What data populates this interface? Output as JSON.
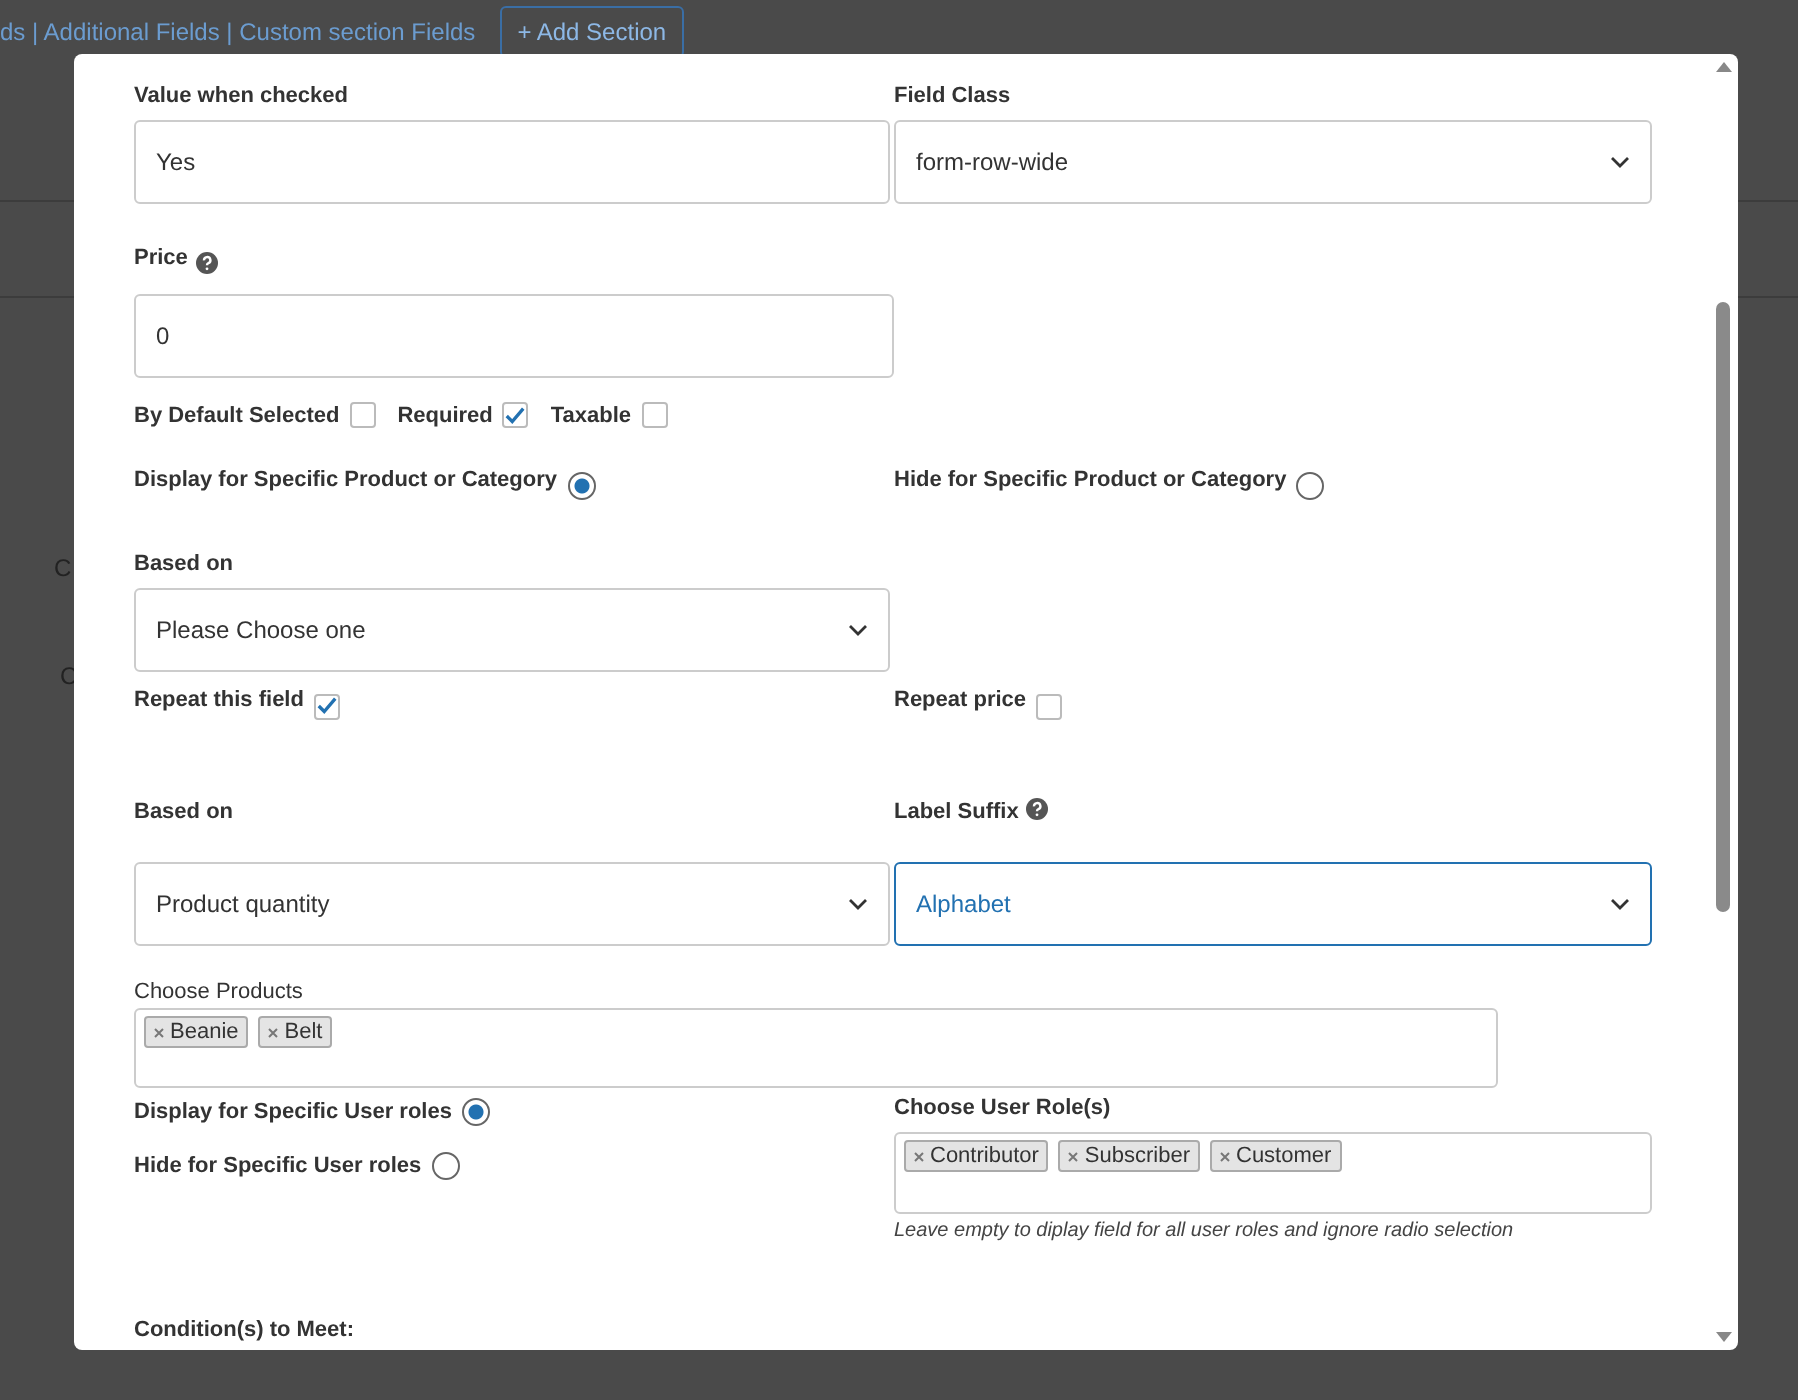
{
  "background": {
    "nav_text": "ds | Additional Fields | Custom section Fields",
    "add_section_button": "+ Add Section",
    "cut_labels": [
      "C",
      "C"
    ]
  },
  "modal": {
    "value_when_checked": {
      "label": "Value when checked",
      "value": "Yes"
    },
    "field_class": {
      "label": "Field Class",
      "value": "form-row-wide"
    },
    "price": {
      "label": "Price",
      "value": "0"
    },
    "checkboxes": [
      {
        "label": "By Default Selected",
        "checked": false
      },
      {
        "label": "Required",
        "checked": true
      },
      {
        "label": "Taxable",
        "checked": false
      }
    ],
    "product_visibility": [
      {
        "label": "Display for Specific Product or Category",
        "selected": true
      },
      {
        "label": "Hide for Specific Product or Category",
        "selected": false
      }
    ],
    "based_on_first": {
      "label": "Based on",
      "value": "Please Choose one"
    },
    "repeat": [
      {
        "label": "Repeat this field",
        "checked": true
      },
      {
        "label": "Repeat price",
        "checked": false
      }
    ],
    "based_on_second": {
      "label": "Based on",
      "value": "Product quantity"
    },
    "label_suffix": {
      "label": "Label Suffix",
      "value": "Alphabet",
      "focused": true
    },
    "choose_products": {
      "label": "Choose Products",
      "tags": [
        "Beanie",
        "Belt"
      ]
    },
    "user_role_visibility": [
      {
        "label": "Display for Specific User roles",
        "selected": true
      },
      {
        "label": "Hide for Specific User roles",
        "selected": false
      }
    ],
    "choose_user_roles": {
      "label": "Choose User Role(s)",
      "tags": [
        "Contributor",
        "Subscriber",
        "Customer"
      ],
      "hint": "Leave empty to diplay field for all user roles and ignore radio selection"
    },
    "conditions": {
      "label": "Condition(s) to Meet:"
    }
  }
}
